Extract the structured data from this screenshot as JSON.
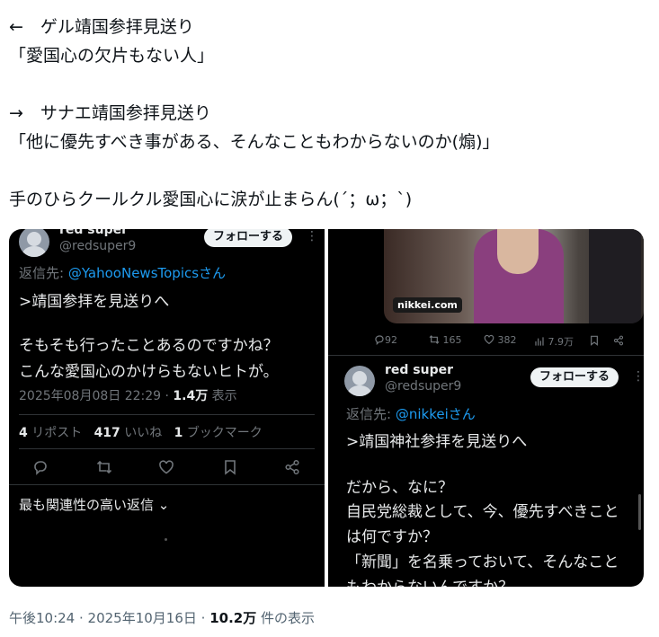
{
  "post": {
    "lines": [
      "←　ゲル靖国参拝見送り",
      "「愛国心の欠片もない人」",
      "",
      "→　サナエ靖国参拝見送り",
      "「他に優先すべき事がある、そんなこともわからないのか(煽)」",
      "",
      "手のひらクールクル愛国心に涙が止まらん(´；ω；`)"
    ]
  },
  "left_panel": {
    "name": "red super",
    "handle": "@redsuper9",
    "follow_label": "フォローする",
    "reply_prefix": "返信先: ",
    "reply_to": "@YahooNewsTopicsさん",
    "quote": ">靖国参拝を見送りへ",
    "body_lines": [
      "そもそも行ったことあるのですかね？",
      "こんな愛国心のかけらもないヒトが。"
    ],
    "timestamp": "2025年08月08日 22:29 · ",
    "views_count": "1.4万",
    "views_label": " 表示",
    "stats": {
      "reposts_count": "4",
      "reposts_label": " リポスト",
      "likes_count": "417",
      "likes_label": " いいね",
      "bookmarks_count": "1",
      "bookmarks_label": " ブックマーク"
    },
    "relevant_replies": "最も関連性の高い返信 ⌄"
  },
  "right_panel": {
    "photo_source": "nikkei.com",
    "action_counts": {
      "replies": "92",
      "reposts": "165",
      "likes": "382",
      "views": "7.9万"
    },
    "name": "red super",
    "handle": "@redsuper9",
    "follow_label": "フォローする",
    "reply_prefix": "返信先: ",
    "reply_to": "@nikkeiさん",
    "quote": ">靖国神社参拝を見送りへ",
    "body_lines": [
      "だから、なに？",
      "自民党総裁として、今、優先すべきこと",
      "は何ですか？",
      "「新聞」を名乗っておいて、そんなこと",
      "もわからないんですか？"
    ]
  },
  "footer": {
    "time": "午後10:24",
    "sep1": " · ",
    "date": "2025年10月16日",
    "sep2": " · ",
    "views_count": "10.2万",
    "views_label": " 件の表示"
  },
  "colors": {
    "link": "#1d9bf0",
    "panel_bg": "#000000",
    "muted": "#71767b",
    "photo_tag_bg": "#1a1a1a"
  }
}
